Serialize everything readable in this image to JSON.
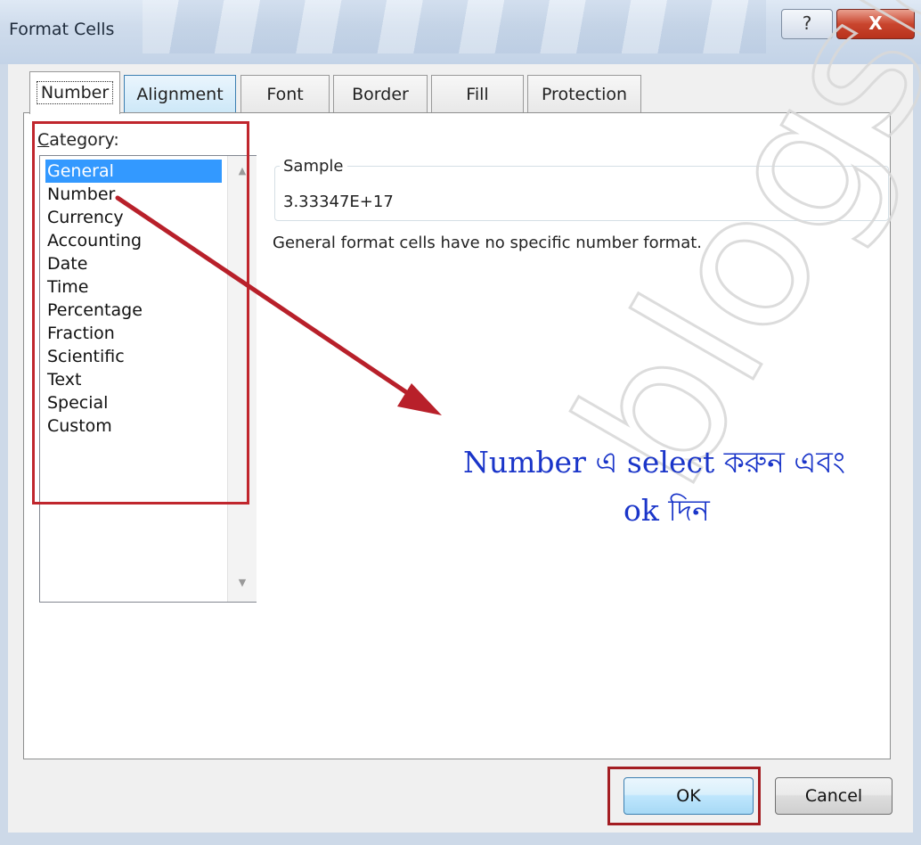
{
  "window": {
    "title": "Format Cells",
    "help_label": "?",
    "close_label": "X"
  },
  "tabs": [
    {
      "label": "Number",
      "active": true
    },
    {
      "label": "Alignment",
      "active": false
    },
    {
      "label": "Font",
      "active": false
    },
    {
      "label": "Border",
      "active": false
    },
    {
      "label": "Fill",
      "active": false
    },
    {
      "label": "Protection",
      "active": false
    }
  ],
  "category": {
    "label_prefix": "C",
    "label_rest": "ategory:",
    "items": [
      "General",
      "Number",
      "Currency",
      "Accounting",
      "Date",
      "Time",
      "Percentage",
      "Fraction",
      "Scientific",
      "Text",
      "Special",
      "Custom"
    ],
    "selected": "General"
  },
  "sample": {
    "title": "Sample",
    "value": "3.33347E+17"
  },
  "description": "General format cells have no specific number format.",
  "annotation": {
    "line1": "Number এ select করুন এবং",
    "line2": "ok দিন"
  },
  "buttons": {
    "ok": "OK",
    "cancel": "Cancel"
  },
  "watermark": "blogspot"
}
